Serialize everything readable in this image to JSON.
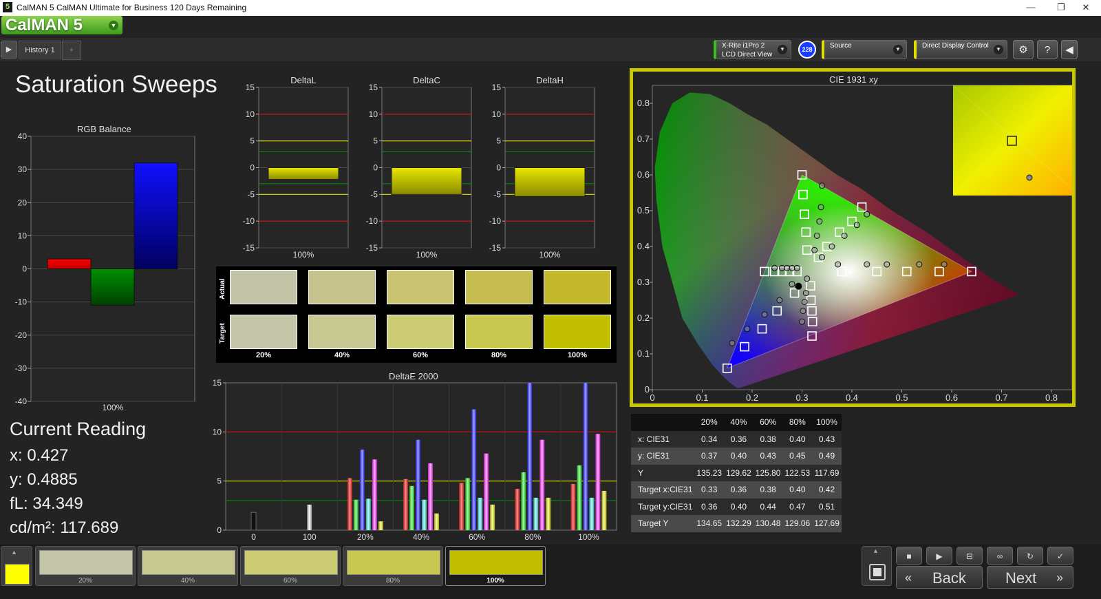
{
  "window": {
    "app_icon": "5",
    "title": "CalMAN 5 CalMAN Ultimate for Business 120 Days Remaining",
    "minimize": "—",
    "restore": "❐",
    "close": "✕"
  },
  "logo": {
    "text": "CalMAN 5",
    "dropdown_icon": "chevron-down-icon"
  },
  "history": {
    "play": "▶",
    "tab_label": "History 1",
    "add": "+"
  },
  "devices": {
    "meter": {
      "line1": "X-Rite i1Pro 2",
      "line2": "LCD Direct View",
      "badge": "228",
      "accent": "#3fbf1f"
    },
    "source": {
      "label": "Source",
      "accent": "#e0e000"
    },
    "display": {
      "label": "Direct Display Control",
      "accent": "#e0e000"
    }
  },
  "toolbar_icons": [
    "gear-icon",
    "help-icon",
    "collapse-icon"
  ],
  "page_title": "Saturation Sweeps",
  "rgb_balance": {
    "title": "RGB Balance",
    "yticks": [
      "40",
      "30",
      "20",
      "10",
      "0",
      "-10",
      "-20",
      "-30",
      "-40"
    ],
    "xlabel": "100%",
    "colors": {
      "red": "#ff0000",
      "green": "#009000",
      "blue": "#1010ff"
    }
  },
  "delta_charts": [
    {
      "title": "DeltaL",
      "xlabel": "100%",
      "yticks": [
        "15",
        "10",
        "5",
        "0",
        "-5",
        "-10",
        "-15"
      ]
    },
    {
      "title": "DeltaC",
      "xlabel": "100%",
      "yticks": [
        "15",
        "10",
        "5",
        "0",
        "-5",
        "-10",
        "-15"
      ]
    },
    {
      "title": "DeltaH",
      "xlabel": "100%",
      "yticks": [
        "15",
        "10",
        "5",
        "0",
        "-5",
        "-10",
        "-15"
      ]
    }
  ],
  "swatches": {
    "actual_label": "Actual",
    "target_label": "Target",
    "labels": [
      "20%",
      "40%",
      "60%",
      "80%",
      "100%"
    ],
    "actual_colors": [
      "#c2c2a6",
      "#c6c38e",
      "#c9c372",
      "#c5bd50",
      "#c3b72c"
    ],
    "target_colors": [
      "#c3c4a8",
      "#c8c892",
      "#cccc74",
      "#c8c850",
      "#c2bf00"
    ]
  },
  "current_reading": {
    "heading": "Current Reading",
    "x": "x: 0.427",
    "y": "y: 0.4885",
    "fl": "fL: 34.349",
    "cdm2": "cd/m²: 117.689"
  },
  "deltae": {
    "title": "DeltaE 2000",
    "yticks": [
      "15",
      "10",
      "5",
      "0"
    ],
    "xticks": [
      "0",
      "100",
      "20%",
      "40%",
      "60%",
      "80%",
      "100%"
    ]
  },
  "cie": {
    "title": "CIE 1931 xy",
    "xticks": [
      "0",
      "0.1",
      "0.2",
      "0.3",
      "0.4",
      "0.5",
      "0.6",
      "0.7",
      "0.8"
    ],
    "yticks": [
      "0.8",
      "0.7",
      "0.6",
      "0.5",
      "0.4",
      "0.3",
      "0.2",
      "0.1",
      "0"
    ]
  },
  "table": {
    "headers": [
      "",
      "20%",
      "40%",
      "60%",
      "80%",
      "100%"
    ],
    "rows": [
      {
        "label": "x: CIE31",
        "values": [
          "0.34",
          "0.36",
          "0.38",
          "0.40",
          "0.43"
        ]
      },
      {
        "label": "y: CIE31",
        "values": [
          "0.37",
          "0.40",
          "0.43",
          "0.45",
          "0.49"
        ]
      },
      {
        "label": "Y",
        "values": [
          "135.23",
          "129.62",
          "125.80",
          "122.53",
          "117.69"
        ]
      },
      {
        "label": "Target x:CIE31",
        "values": [
          "0.33",
          "0.36",
          "0.38",
          "0.40",
          "0.42"
        ]
      },
      {
        "label": "Target y:CIE31",
        "values": [
          "0.36",
          "0.40",
          "0.44",
          "0.47",
          "0.51"
        ]
      },
      {
        "label": "Target Y",
        "values": [
          "134.65",
          "132.29",
          "130.48",
          "129.06",
          "127.69"
        ]
      }
    ]
  },
  "bottom": {
    "current_color": "#ffff00",
    "cards": [
      {
        "label": "20%",
        "color": "#c3c4a8"
      },
      {
        "label": "40%",
        "color": "#c8c892"
      },
      {
        "label": "60%",
        "color": "#cccc74"
      },
      {
        "label": "80%",
        "color": "#c8c850"
      },
      {
        "label": "100%",
        "color": "#c2bf00"
      }
    ],
    "back_label": "Back",
    "next_label": "Next",
    "controls": [
      "stop-icon",
      "play-icon",
      "fit-icon",
      "loop-icon",
      "refresh-icon",
      "check-icon"
    ]
  },
  "chart_data": [
    {
      "type": "bar",
      "title": "RGB Balance",
      "categories": [
        "100%"
      ],
      "series": [
        {
          "name": "Red",
          "values": [
            3
          ]
        },
        {
          "name": "Green",
          "values": [
            -11
          ]
        },
        {
          "name": "Blue",
          "values": [
            32
          ]
        }
      ],
      "ylim": [
        -40,
        40
      ]
    },
    {
      "type": "bar",
      "title": "DeltaL",
      "categories": [
        "100%"
      ],
      "values": [
        -2.2
      ],
      "ylim": [
        -15,
        15
      ]
    },
    {
      "type": "bar",
      "title": "DeltaC",
      "categories": [
        "100%"
      ],
      "values": [
        -5.0
      ],
      "ylim": [
        -15,
        15
      ]
    },
    {
      "type": "bar",
      "title": "DeltaH",
      "categories": [
        "100%"
      ],
      "values": [
        -5.4
      ],
      "ylim": [
        -15,
        15
      ]
    },
    {
      "type": "bar",
      "title": "DeltaE 2000",
      "categories": [
        "0",
        "100",
        "20%",
        "40%",
        "60%",
        "80%",
        "100%"
      ],
      "series": [
        {
          "name": "White",
          "values": [
            1.8,
            2.6,
            0,
            0,
            0,
            0,
            0
          ]
        },
        {
          "name": "Red",
          "values": [
            0,
            0,
            5.3,
            5.2,
            4.8,
            4.2,
            4.7
          ]
        },
        {
          "name": "Green",
          "values": [
            0,
            0,
            3.1,
            4.5,
            5.3,
            5.9,
            6.6
          ]
        },
        {
          "name": "Blue",
          "values": [
            0,
            0,
            8.2,
            9.2,
            12.3,
            15.0,
            15.0
          ]
        },
        {
          "name": "Cyan",
          "values": [
            0,
            0,
            3.2,
            3.1,
            3.3,
            3.3,
            3.3
          ]
        },
        {
          "name": "Magenta",
          "values": [
            0,
            0,
            7.2,
            6.8,
            7.8,
            9.2,
            9.8
          ]
        },
        {
          "name": "Yellow",
          "values": [
            0,
            0,
            0.9,
            1.7,
            2.6,
            3.3,
            4.0
          ]
        }
      ],
      "ylim": [
        0,
        15
      ],
      "reference_lines": [
        10,
        5,
        3
      ]
    },
    {
      "type": "scatter",
      "title": "CIE 1931 xy",
      "xlim": [
        0,
        0.8
      ],
      "ylim": [
        0,
        0.85
      ],
      "gamut_triangle": [
        [
          0.64,
          0.33
        ],
        [
          0.3,
          0.6
        ],
        [
          0.15,
          0.06
        ]
      ],
      "white_point": [
        0.313,
        0.329
      ],
      "targets": [
        [
          0.64,
          0.33
        ],
        [
          0.575,
          0.33
        ],
        [
          0.51,
          0.33
        ],
        [
          0.45,
          0.33
        ],
        [
          0.38,
          0.33
        ],
        [
          0.3,
          0.6
        ],
        [
          0.302,
          0.545
        ],
        [
          0.305,
          0.49
        ],
        [
          0.308,
          0.44
        ],
        [
          0.31,
          0.39
        ],
        [
          0.15,
          0.06
        ],
        [
          0.185,
          0.12
        ],
        [
          0.22,
          0.17
        ],
        [
          0.25,
          0.22
        ],
        [
          0.285,
          0.27
        ],
        [
          0.225,
          0.33
        ],
        [
          0.245,
          0.33
        ],
        [
          0.26,
          0.33
        ],
        [
          0.275,
          0.33
        ],
        [
          0.29,
          0.33
        ],
        [
          0.42,
          0.51
        ],
        [
          0.4,
          0.47
        ],
        [
          0.375,
          0.44
        ],
        [
          0.35,
          0.4
        ],
        [
          0.333,
          0.37
        ],
        [
          0.32,
          0.15
        ],
        [
          0.321,
          0.19
        ],
        [
          0.32,
          0.22
        ],
        [
          0.318,
          0.25
        ],
        [
          0.317,
          0.29
        ]
      ],
      "measured": [
        [
          0.585,
          0.35
        ],
        [
          0.535,
          0.35
        ],
        [
          0.47,
          0.35
        ],
        [
          0.43,
          0.35
        ],
        [
          0.372,
          0.35
        ],
        [
          0.34,
          0.57
        ],
        [
          0.338,
          0.51
        ],
        [
          0.335,
          0.47
        ],
        [
          0.33,
          0.43
        ],
        [
          0.325,
          0.39
        ],
        [
          0.16,
          0.13
        ],
        [
          0.19,
          0.17
        ],
        [
          0.225,
          0.21
        ],
        [
          0.255,
          0.25
        ],
        [
          0.28,
          0.295
        ],
        [
          0.245,
          0.34
        ],
        [
          0.26,
          0.34
        ],
        [
          0.27,
          0.34
        ],
        [
          0.28,
          0.34
        ],
        [
          0.29,
          0.34
        ],
        [
          0.43,
          0.49
        ],
        [
          0.41,
          0.46
        ],
        [
          0.385,
          0.43
        ],
        [
          0.36,
          0.4
        ],
        [
          0.34,
          0.37
        ],
        [
          0.3,
          0.19
        ],
        [
          0.302,
          0.22
        ],
        [
          0.305,
          0.245
        ],
        [
          0.308,
          0.27
        ],
        [
          0.31,
          0.31
        ]
      ],
      "inset_points": {
        "target": [
          0.42,
          0.51
        ],
        "measured": [
          0.427,
          0.4885
        ]
      }
    }
  ]
}
